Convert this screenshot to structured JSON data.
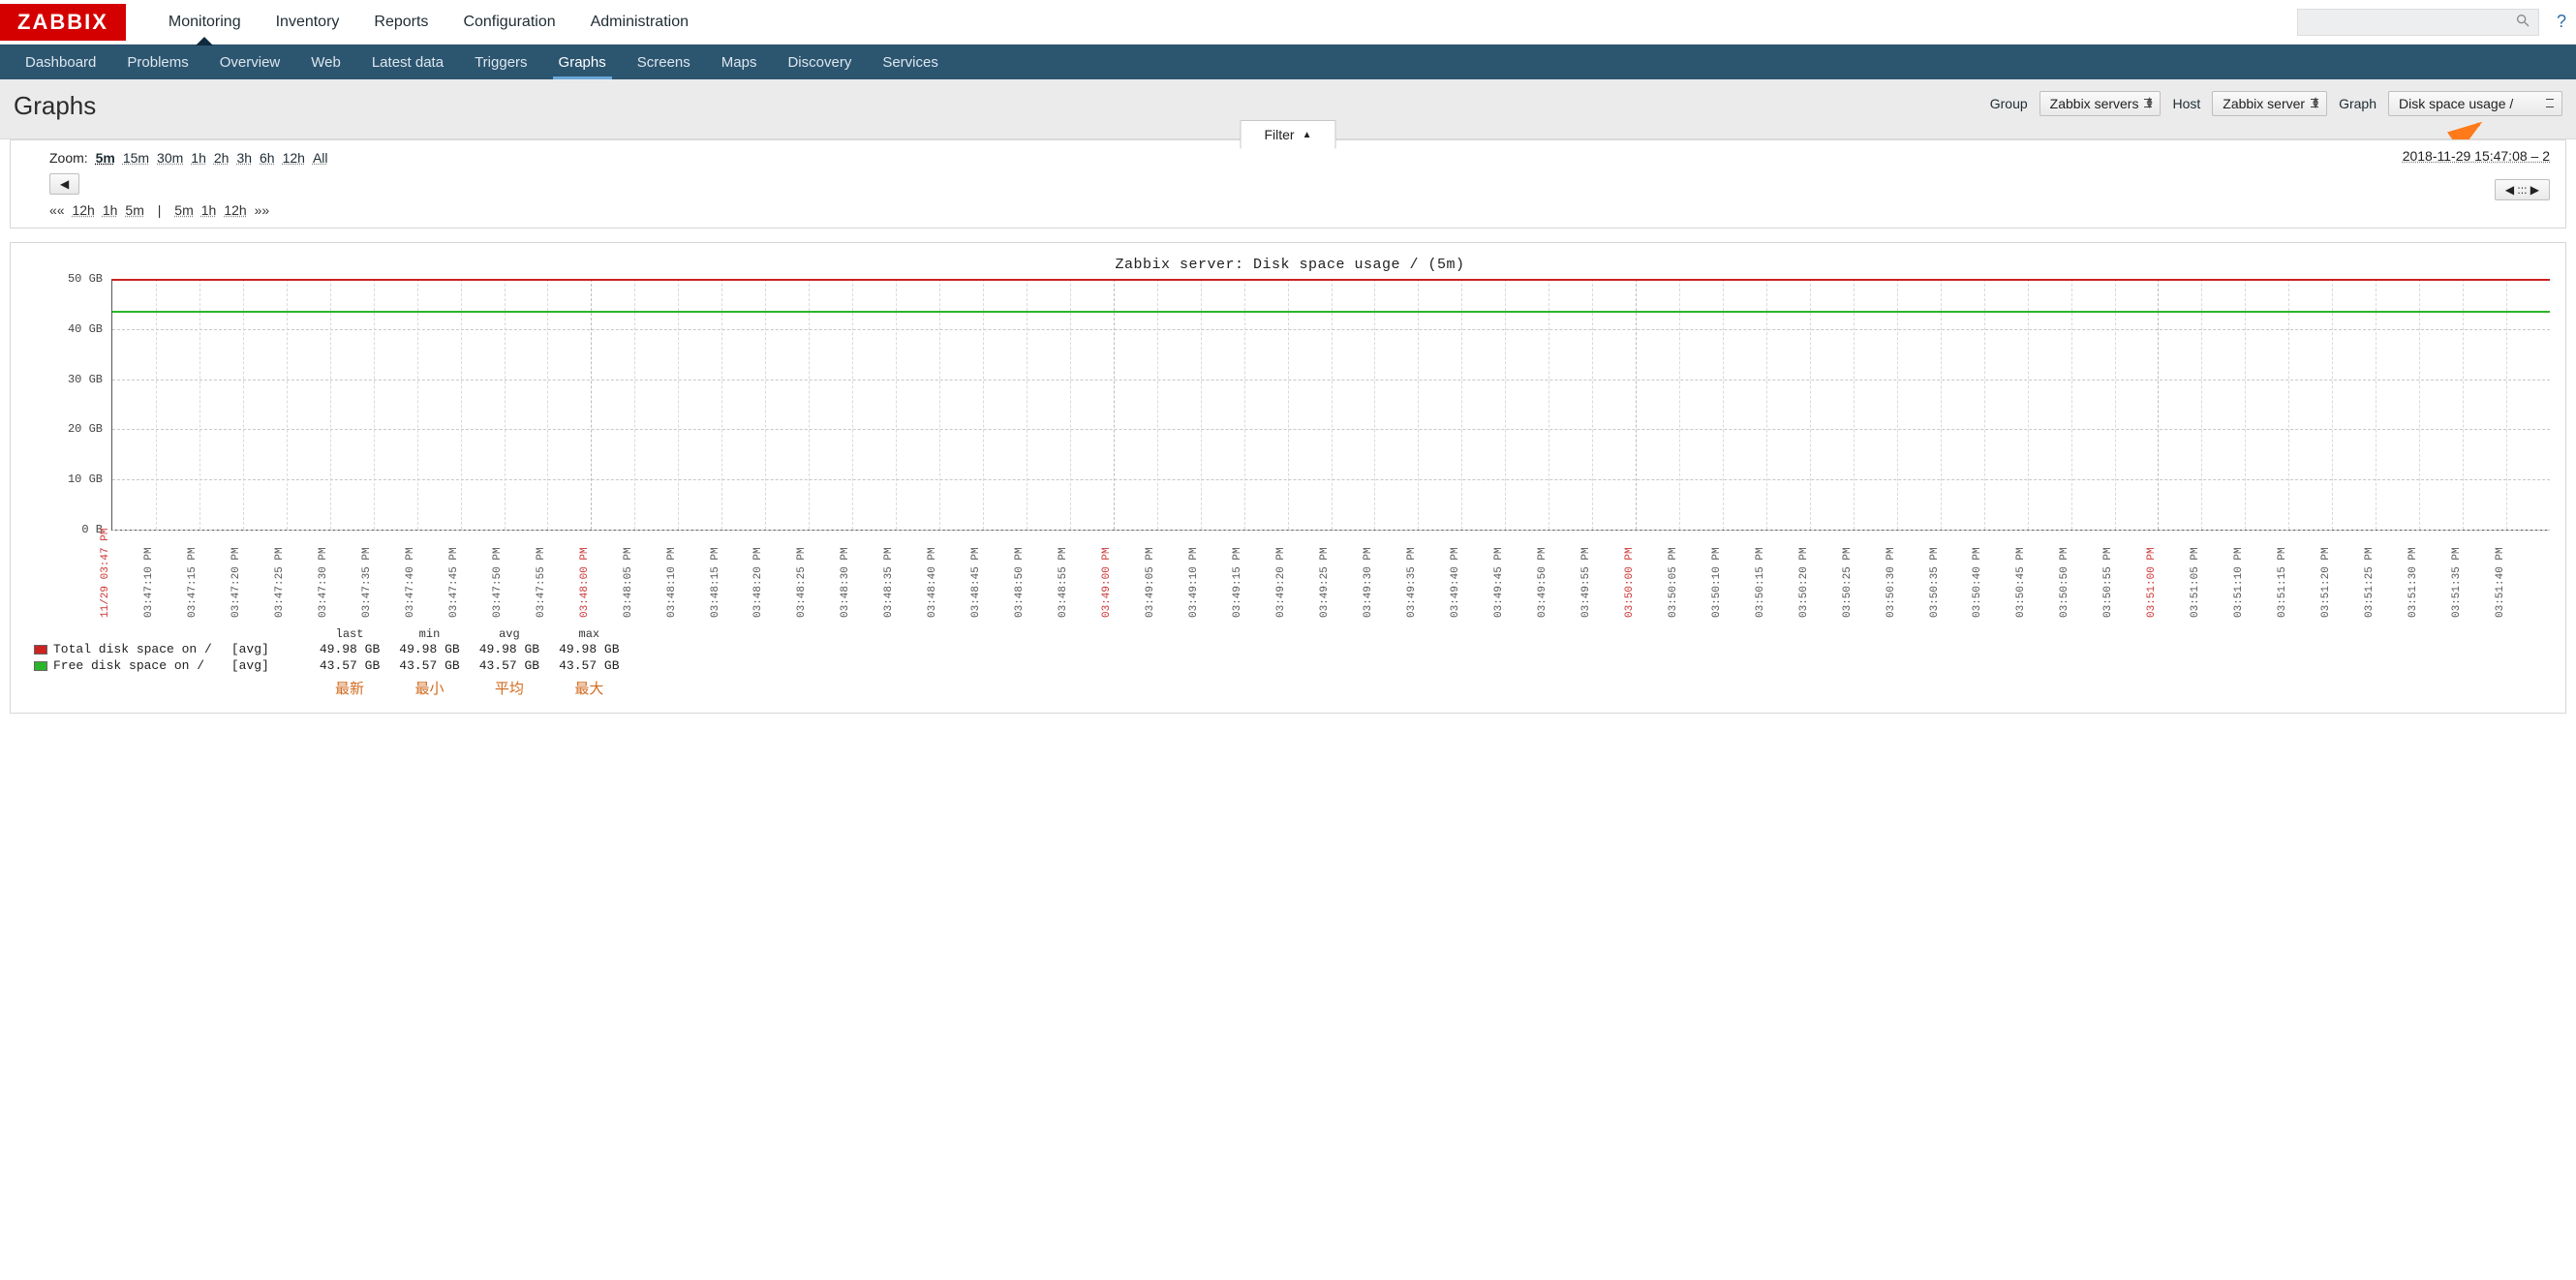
{
  "logo": "ZABBIX",
  "topnav": [
    {
      "label": "Monitoring",
      "active": true
    },
    {
      "label": "Inventory"
    },
    {
      "label": "Reports"
    },
    {
      "label": "Configuration"
    },
    {
      "label": "Administration"
    }
  ],
  "subnav": [
    {
      "label": "Dashboard"
    },
    {
      "label": "Problems"
    },
    {
      "label": "Overview"
    },
    {
      "label": "Web"
    },
    {
      "label": "Latest data"
    },
    {
      "label": "Triggers"
    },
    {
      "label": "Graphs",
      "active": true
    },
    {
      "label": "Screens"
    },
    {
      "label": "Maps"
    },
    {
      "label": "Discovery"
    },
    {
      "label": "Services"
    }
  ],
  "help_icon": "?",
  "page_title": "Graphs",
  "filters": {
    "group_label": "Group",
    "group_value": "Zabbix servers",
    "host_label": "Host",
    "host_value": "Zabbix server",
    "graph_label": "Graph",
    "graph_value": "Disk space usage /"
  },
  "filter_tab": {
    "label": "Filter",
    "arrow": "▲"
  },
  "zoom": {
    "label": "Zoom:",
    "options": [
      "5m",
      "15m",
      "30m",
      "1h",
      "2h",
      "3h",
      "6h",
      "12h",
      "All"
    ],
    "selected": "5m"
  },
  "time_range": "2018-11-29 15:47:08 – 2",
  "nav_prev": "◀",
  "nav_next_grip": "◀ ::: ▶",
  "quick": {
    "left_marker": "««",
    "left": [
      "12h",
      "1h",
      "5m"
    ],
    "sep": "|",
    "right": [
      "5m",
      "1h",
      "12h"
    ],
    "right_marker": "»»"
  },
  "chart_data": {
    "type": "line",
    "title": "Zabbix server: Disk space usage / (5m)",
    "ylabel": "",
    "ylim": [
      0,
      50
    ],
    "y_unit": "GB",
    "y_ticks": [
      {
        "v": 0,
        "label": "0 B"
      },
      {
        "v": 10,
        "label": "10 GB"
      },
      {
        "v": 20,
        "label": "20 GB"
      },
      {
        "v": 30,
        "label": "30 GB"
      },
      {
        "v": 40,
        "label": "40 GB"
      },
      {
        "v": 50,
        "label": "50 GB"
      }
    ],
    "x_start_label": "11/29 03:47 PM",
    "x_tick_interval_seconds": 5,
    "x_major_every": 12,
    "x": [
      "03:47:10 PM",
      "03:47:15 PM",
      "03:47:20 PM",
      "03:47:25 PM",
      "03:47:30 PM",
      "03:47:35 PM",
      "03:47:40 PM",
      "03:47:45 PM",
      "03:47:50 PM",
      "03:47:55 PM",
      "03:48:00 PM",
      "03:48:05 PM",
      "03:48:10 PM",
      "03:48:15 PM",
      "03:48:20 PM",
      "03:48:25 PM",
      "03:48:30 PM",
      "03:48:35 PM",
      "03:48:40 PM",
      "03:48:45 PM",
      "03:48:50 PM",
      "03:48:55 PM",
      "03:49:00 PM",
      "03:49:05 PM",
      "03:49:10 PM",
      "03:49:15 PM",
      "03:49:20 PM",
      "03:49:25 PM",
      "03:49:30 PM",
      "03:49:35 PM",
      "03:49:40 PM",
      "03:49:45 PM",
      "03:49:50 PM",
      "03:49:55 PM",
      "03:50:00 PM",
      "03:50:05 PM",
      "03:50:10 PM",
      "03:50:15 PM",
      "03:50:20 PM",
      "03:50:25 PM",
      "03:50:30 PM",
      "03:50:35 PM",
      "03:50:40 PM",
      "03:50:45 PM",
      "03:50:50 PM",
      "03:50:55 PM",
      "03:51:00 PM",
      "03:51:05 PM",
      "03:51:10 PM",
      "03:51:15 PM",
      "03:51:20 PM",
      "03:51:25 PM",
      "03:51:30 PM",
      "03:51:35 PM",
      "03:51:40 PM"
    ],
    "x_major": [
      "03:48:00 PM",
      "03:49:00 PM",
      "03:50:00 PM",
      "03:51:00 PM"
    ],
    "series": [
      {
        "name": "Total disk space on /",
        "agg": "[avg]",
        "color": "#cc2222",
        "last": "49.98 GB",
        "min": "49.98 GB",
        "avg": "49.98 GB",
        "max": "49.98 GB",
        "value": 49.98
      },
      {
        "name": "Free disk space on /",
        "agg": "[avg]",
        "color": "#2ab52a",
        "last": "43.57 GB",
        "min": "43.57 GB",
        "avg": "43.57 GB",
        "max": "43.57 GB",
        "value": 43.57
      }
    ],
    "legend_cols": [
      "last",
      "min",
      "avg",
      "max"
    ]
  },
  "annotations": {
    "cn_labels": [
      "最新",
      "最小",
      "平均",
      "最大"
    ]
  }
}
